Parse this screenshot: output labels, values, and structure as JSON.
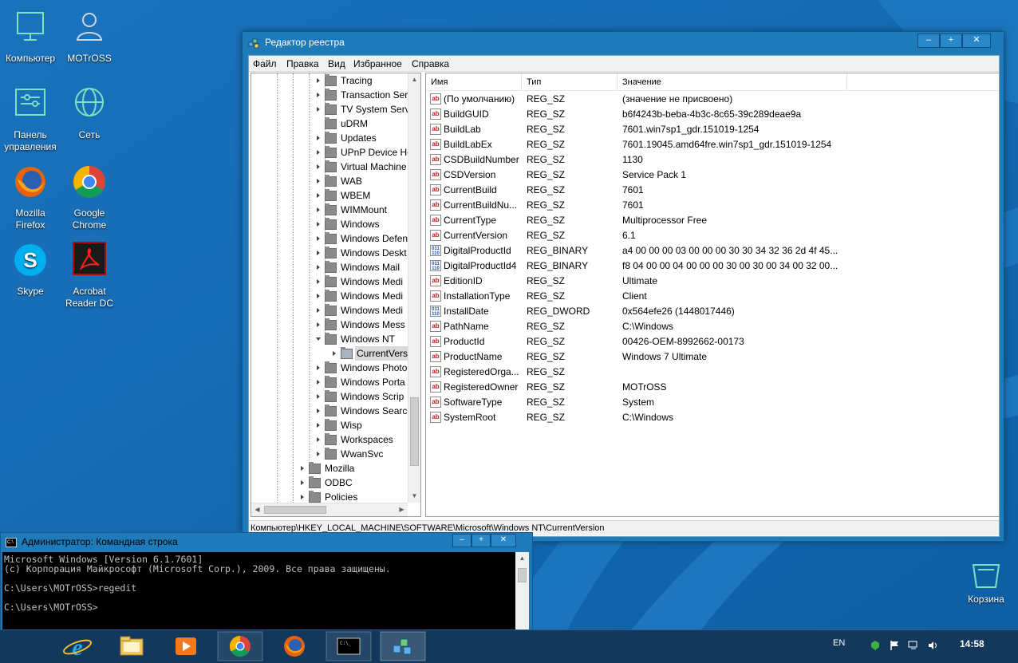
{
  "desktop": {
    "icons": [
      {
        "label": "Компьютер"
      },
      {
        "label": "MOTrOSS"
      },
      {
        "label": "Панель управления"
      },
      {
        "label": "Сеть"
      },
      {
        "label": "Mozilla Firefox"
      },
      {
        "label": "Google Chrome"
      },
      {
        "label": "Skype"
      },
      {
        "label": "Acrobat Reader DC"
      }
    ],
    "recycle_bin": "Корзина"
  },
  "regedit": {
    "title": "Редактор реестра",
    "menu": [
      "Файл",
      "Правка",
      "Вид",
      "Избранное",
      "Справка"
    ],
    "tree": [
      "Tracing",
      "Transaction Ser",
      "TV System Serv",
      "uDRM",
      "Updates",
      "UPnP Device Ho",
      "Virtual Machine",
      "WAB",
      "WBEM",
      "WIMMount",
      "Windows",
      "Windows Defen",
      "Windows Deskt",
      "Windows Mail",
      "Windows Medi",
      "Windows Medi",
      "Windows Medi",
      "Windows Mess",
      "Windows NT",
      "CurrentVersi",
      "Windows Photo",
      "Windows Porta",
      "Windows Scrip",
      "Windows Searc",
      "Wisp",
      "Workspaces",
      "WwanSvc",
      "Mozilla",
      "ODBC",
      "Policies"
    ],
    "columns": {
      "name": "Имя",
      "type": "Тип",
      "value": "Значение"
    },
    "values": [
      {
        "name": "(По умолчанию)",
        "type": "REG_SZ",
        "value": "(значение не присвоено)",
        "icon": "string-value-icon"
      },
      {
        "name": "BuildGUID",
        "type": "REG_SZ",
        "value": "b6f4243b-beba-4b3c-8c65-39c289deae9a",
        "icon": "string-value-icon"
      },
      {
        "name": "BuildLab",
        "type": "REG_SZ",
        "value": "7601.win7sp1_gdr.151019-1254",
        "icon": "string-value-icon"
      },
      {
        "name": "BuildLabEx",
        "type": "REG_SZ",
        "value": "7601.19045.amd64fre.win7sp1_gdr.151019-1254",
        "icon": "string-value-icon"
      },
      {
        "name": "CSDBuildNumber",
        "type": "REG_SZ",
        "value": "1130",
        "icon": "string-value-icon"
      },
      {
        "name": "CSDVersion",
        "type": "REG_SZ",
        "value": "Service Pack 1",
        "icon": "string-value-icon"
      },
      {
        "name": "CurrentBuild",
        "type": "REG_SZ",
        "value": "7601",
        "icon": "string-value-icon"
      },
      {
        "name": "CurrentBuildNu...",
        "type": "REG_SZ",
        "value": "7601",
        "icon": "string-value-icon"
      },
      {
        "name": "CurrentType",
        "type": "REG_SZ",
        "value": "Multiprocessor Free",
        "icon": "string-value-icon"
      },
      {
        "name": "CurrentVersion",
        "type": "REG_SZ",
        "value": "6.1",
        "icon": "string-value-icon"
      },
      {
        "name": "DigitalProductId",
        "type": "REG_BINARY",
        "value": "a4 00 00 00 03 00 00 00 30 30 34 32 36 2d 4f 45...",
        "icon": "binary-value-icon"
      },
      {
        "name": "DigitalProductId4",
        "type": "REG_BINARY",
        "value": "f8 04 00 00 04 00 00 00 30 00 30 00 34 00 32 00...",
        "icon": "binary-value-icon"
      },
      {
        "name": "EditionID",
        "type": "REG_SZ",
        "value": "Ultimate",
        "icon": "string-value-icon"
      },
      {
        "name": "InstallationType",
        "type": "REG_SZ",
        "value": "Client",
        "icon": "string-value-icon"
      },
      {
        "name": "InstallDate",
        "type": "REG_DWORD",
        "value": "0x564efe26 (1448017446)",
        "icon": "binary-value-icon"
      },
      {
        "name": "PathName",
        "type": "REG_SZ",
        "value": "C:\\Windows",
        "icon": "string-value-icon"
      },
      {
        "name": "ProductId",
        "type": "REG_SZ",
        "value": "00426-OEM-8992662-00173",
        "icon": "string-value-icon"
      },
      {
        "name": "ProductName",
        "type": "REG_SZ",
        "value": "Windows 7 Ultimate",
        "icon": "string-value-icon"
      },
      {
        "name": "RegisteredOrga...",
        "type": "REG_SZ",
        "value": "",
        "icon": "string-value-icon"
      },
      {
        "name": "RegisteredOwner",
        "type": "REG_SZ",
        "value": "MOTrOSS",
        "icon": "string-value-icon"
      },
      {
        "name": "SoftwareType",
        "type": "REG_SZ",
        "value": "System",
        "icon": "string-value-icon"
      },
      {
        "name": "SystemRoot",
        "type": "REG_SZ",
        "value": "C:\\Windows",
        "icon": "string-value-icon"
      }
    ],
    "status": "Компьютер\\HKEY_LOCAL_MACHINE\\SOFTWARE\\Microsoft\\Windows NT\\CurrentVersion"
  },
  "cmd": {
    "title": "Администратор: Командная строка",
    "lines": [
      "Microsoft Windows [Version 6.1.7601]",
      "(c) Корпорация Майкрософт (Microsoft Corp.), 2009. Все права защищены.",
      "",
      "C:\\Users\\MOTrOSS>regedit",
      "",
      "C:\\Users\\MOTrOSS>"
    ]
  },
  "taskbar": {
    "language": "EN",
    "clock": "14:58"
  }
}
